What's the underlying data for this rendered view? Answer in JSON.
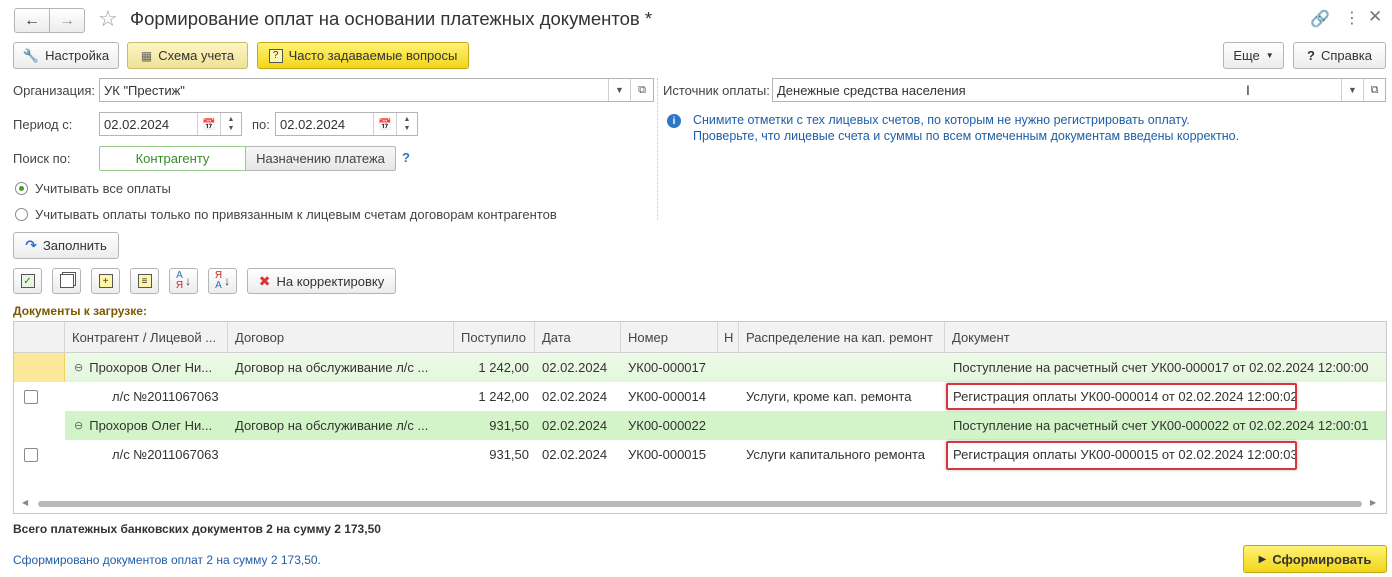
{
  "window": {
    "title": "Формирование оплат на основании платежных документов *"
  },
  "toolbar": {
    "settings": "Настройка",
    "scheme": "Схема учета",
    "faq": "Часто задаваемые вопросы",
    "more": "Еще",
    "help_mark": "?",
    "help": "Справка"
  },
  "form": {
    "org_label": "Организация:",
    "org_value": "УК \"Престиж\"",
    "period_label": "Период с:",
    "period_from": "02.02.2024",
    "period_to_label": "по:",
    "period_to": "02.02.2024",
    "search_label": "Поиск по:",
    "search_opt1": "Контрагенту",
    "search_opt2": "Назначению платежа",
    "search_help": "?",
    "radio1": "Учитывать все оплаты",
    "radio2": "Учитывать оплаты только по привязанным к лицевым счетам договорам контрагентов",
    "source_label": "Источник оплаты:",
    "source_value": "Денежные средства населения",
    "info_icon": "i",
    "info_line1": "Снимите отметки с тех лицевых счетов, по которым не нужно регистрировать оплату.",
    "info_line2": "Проверьте, что лицевые счета и суммы по всем отмеченным документам введены корректно.",
    "fill_button": "Заполнить",
    "correct_button": "На корректировку"
  },
  "table": {
    "section_title": "Документы к загрузке:",
    "columns": [
      "Контрагент / Лицевой ...",
      "Договор",
      "Поступило",
      "Дата",
      "Номер",
      "Н",
      "Распределение на кап. ремонт",
      "Документ"
    ],
    "rows": [
      {
        "contractor": "Прохоров Олег Ни...",
        "contract": "Договор на обслуживание л/с ...",
        "amount": "1 242,00",
        "date": "02.02.2024",
        "number": "УК00-000017",
        "distribution": "",
        "document": "Поступление на расчетный счет УК00-000017 от 02.02.2024 12:00:00"
      },
      {
        "contractor": "л/с №2011067063",
        "contract": "",
        "amount": "1 242,00",
        "date": "02.02.2024",
        "number": "УК00-000014",
        "distribution": "Услуги, кроме кап. ремонта",
        "document": "Регистрация оплаты УК00-000014 от 02.02.2024 12:00:02"
      },
      {
        "contractor": "Прохоров Олег Ни...",
        "contract": "Договор на обслуживание л/с ...",
        "amount": "931,50",
        "date": "02.02.2024",
        "number": "УК00-000022",
        "distribution": "",
        "document": "Поступление на расчетный счет УК00-000022 от 02.02.2024 12:00:01"
      },
      {
        "contractor": "л/с №2011067063",
        "contract": "",
        "amount": "931,50",
        "date": "02.02.2024",
        "number": "УК00-000015",
        "distribution": "Услуги капитального ремонта",
        "document": "Регистрация оплаты УК00-000015 от 02.02.2024 12:00:03"
      }
    ]
  },
  "footer": {
    "total": "Всего платежных банковских документов 2 на сумму 2 173,50",
    "formed": "Сформировано документов оплат 2 на сумму 2 173,50.",
    "create_button": "Сформировать"
  },
  "colors": {
    "accent_yellow": "#f5dc20",
    "group_row_green": "#d8f5d0",
    "group_row_green_alt": "#eefaea",
    "link_blue": "#1f5ea8",
    "highlight_red": "#d9353c"
  }
}
